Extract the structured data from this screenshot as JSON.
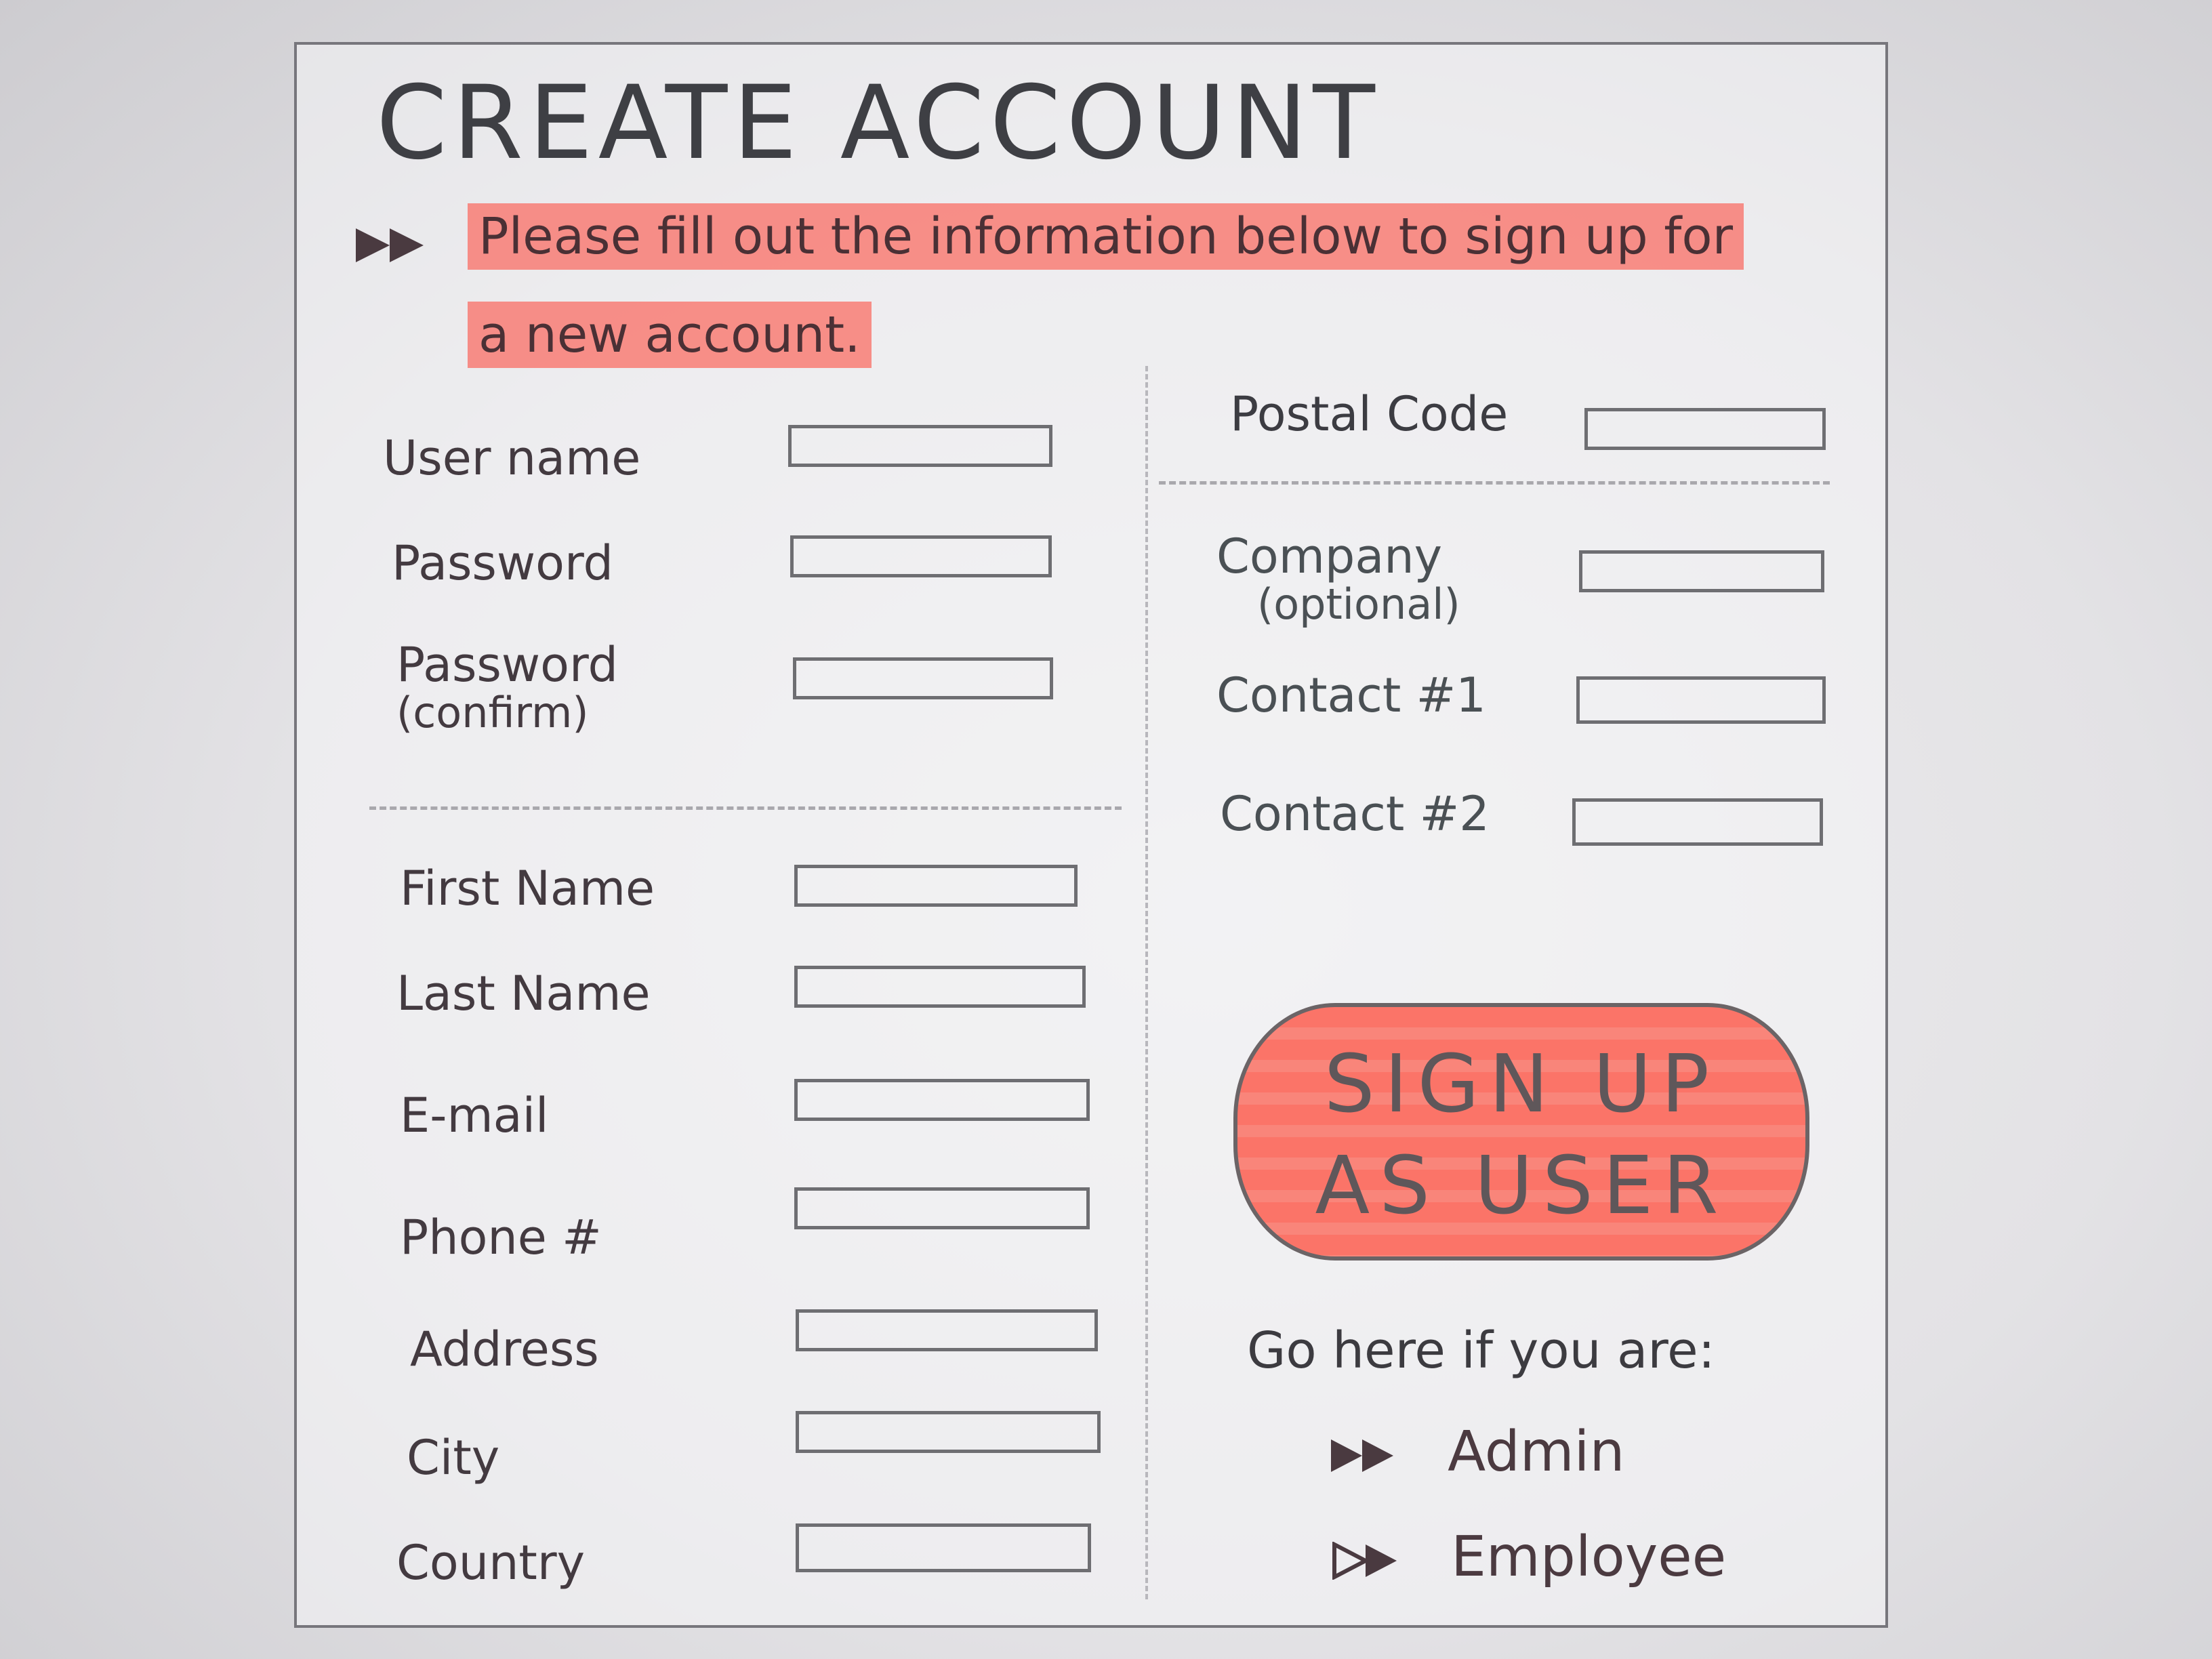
{
  "title": "CREATE ACCOUNT",
  "intro": {
    "line1": "Please fill out the information below to sign up for",
    "line2": "a new account."
  },
  "left_fields": [
    {
      "label": "User name",
      "sub": ""
    },
    {
      "label": "Password",
      "sub": ""
    },
    {
      "label": "Password",
      "sub": "(confirm)"
    },
    {
      "label": "First Name",
      "sub": ""
    },
    {
      "label": "Last Name",
      "sub": ""
    },
    {
      "label": "E-mail",
      "sub": ""
    },
    {
      "label": "Phone #",
      "sub": ""
    },
    {
      "label": "Address",
      "sub": ""
    },
    {
      "label": "City",
      "sub": ""
    },
    {
      "label": "Country",
      "sub": ""
    }
  ],
  "right_fields": [
    {
      "label": "Postal Code",
      "sub": ""
    },
    {
      "label": "Company",
      "sub": "(optional)"
    },
    {
      "label": "Contact #1",
      "sub": ""
    },
    {
      "label": "Contact #2",
      "sub": ""
    }
  ],
  "signup_button": {
    "line1": "SIGN UP",
    "line2": "AS USER"
  },
  "go_here_text": "Go here if you are:",
  "role_links": {
    "admin": "Admin",
    "employee": "Employee"
  },
  "icons": {
    "arrow": "double-arrow-icon"
  },
  "colors": {
    "highlight": "#fa6e64",
    "button": "#fb7468",
    "ink": "#3e3f44"
  }
}
